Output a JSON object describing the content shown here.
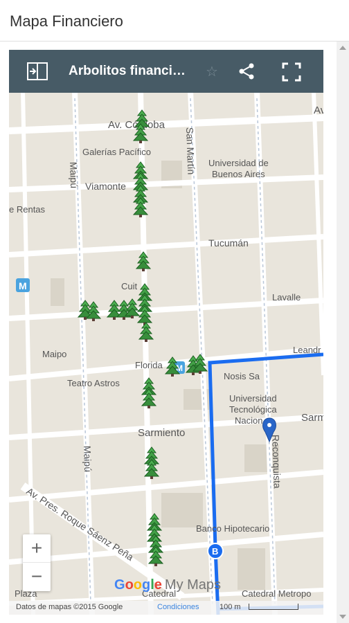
{
  "app": {
    "title": "Mapa Financiero"
  },
  "map": {
    "title": "Arbolitos financi…",
    "star_icon": "☆",
    "zoom_in": "+",
    "zoom_out": "−",
    "logo": {
      "g1": "G",
      "g2": "o",
      "g3": "o",
      "g4": "g",
      "g5": "l",
      "g6": "e",
      "mymaps": "My Maps"
    },
    "attribution": "Datos de mapas ©2015 Google",
    "terms_link": "Condiciones",
    "scale_label": "100 m",
    "colors": {
      "route": "#1a6cf0",
      "tree": "#2e8b2e",
      "pin": "#2a66c8",
      "toolbar": "#475b66"
    }
  },
  "labels": {
    "av_cordoba": "Av. Córdoba",
    "av_edge": "Av",
    "galerias": "Galerías Pacífico",
    "san_martin": "San Martín",
    "uba1": "Universidad de",
    "uba2": "Buenos Aires",
    "maipu_top": "Maipú",
    "viamonte": "Viamonte",
    "rentas": "e Rentas",
    "tucuman": "Tucumán",
    "cuit": "Cuit",
    "lavalle": "Lavalle",
    "leandro": "Leandr",
    "maipo": "Maipo",
    "florida": "Florida",
    "nosis": "Nosis Sa",
    "teatro": "Teatro Astros",
    "utn1": "Universidad",
    "utn2": "Tecnológica",
    "utn3": "Nacion",
    "sarmiento": "Sarmiento",
    "sarm_edge": "Sarm",
    "maipu_bottom": "Maipú",
    "reconquista": "Reconquista",
    "av_pres": "Av. Pres. Roque Sáenz Peña",
    "banco": "Banco Hipotecario",
    "plaza": "Plaza",
    "catedral": "Catedral",
    "catedral_metro": "Catedral Metropo",
    "marker_b": "B",
    "subway": "M"
  }
}
